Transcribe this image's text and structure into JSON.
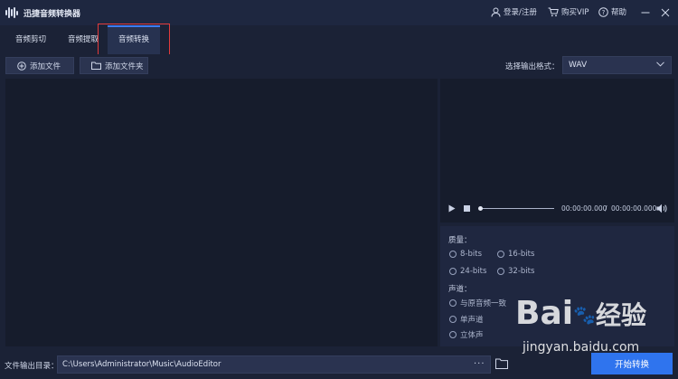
{
  "app": {
    "title": "迅捷音频转换器"
  },
  "titlebar": {
    "login": "登录/注册",
    "buy_vip": "购买VIP",
    "help": "帮助"
  },
  "tabs": [
    {
      "label": "音频剪切",
      "active": false
    },
    {
      "label": "音频提取",
      "active": false
    },
    {
      "label": "音频转换",
      "active": true
    }
  ],
  "toolbar": {
    "add_file": "添加文件",
    "add_folder": "添加文件夹",
    "format_label": "选择输出格式：",
    "format_value": "WAV"
  },
  "player": {
    "current_time": "00:00:00.000",
    "separator": "/",
    "total_time": "00:00:00.000",
    "progress": 0
  },
  "settings": {
    "quality_label": "质量：",
    "quality_options": [
      "8-bits",
      "16-bits",
      "24-bits",
      "32-bits"
    ],
    "channel_label": "声道：",
    "channel_options": [
      "与原音频一致",
      "单声道",
      "立体声"
    ]
  },
  "output": {
    "label": "文件输出目录：",
    "path": "C:\\Users\\Administrator\\Music\\AudioEditor",
    "dots": "···",
    "start_button": "开始转换"
  },
  "watermark": {
    "brand": "Bai",
    "brand2": "经验",
    "url": "jingyan.baidu.com"
  },
  "colors": {
    "accent": "#2f74ee",
    "highlight": "#e23b3b",
    "background": "#1b2236",
    "panel": "#161c2c"
  }
}
